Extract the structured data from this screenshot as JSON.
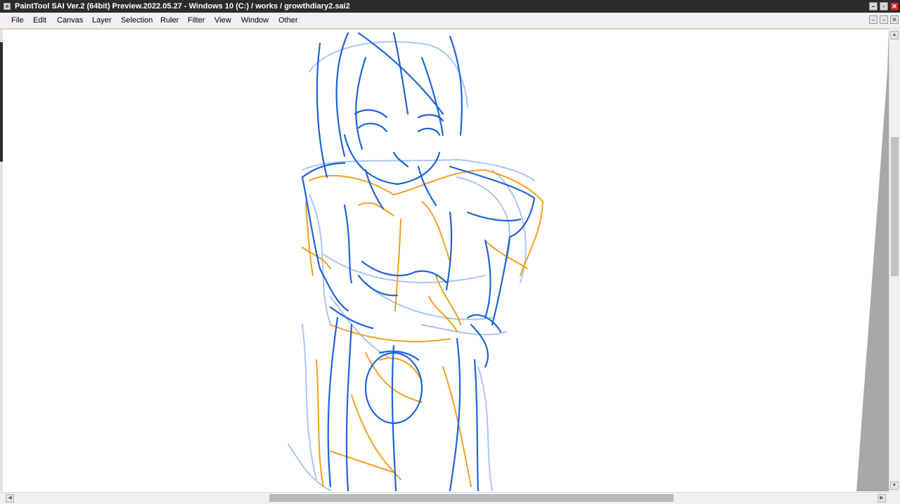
{
  "window": {
    "title": "PaintTool SAI Ver.2 (64bit) Preview.2022.05.27 - Windows 10 (C:) / works / growthdiary2.sai2",
    "minimize_glyph": "–",
    "maximize_glyph": "▫",
    "close_glyph": "✕"
  },
  "menu": {
    "items": [
      {
        "label": "File"
      },
      {
        "label": "Edit"
      },
      {
        "label": "Canvas"
      },
      {
        "label": "Layer"
      },
      {
        "label": "Selection"
      },
      {
        "label": "Ruler"
      },
      {
        "label": "Filter"
      },
      {
        "label": "View"
      },
      {
        "label": "Window"
      },
      {
        "label": "Other"
      }
    ],
    "doc_minimize_glyph": "–",
    "doc_restore_glyph": "▫",
    "doc_close_glyph": "✕"
  },
  "canvas": {
    "content": "sketch-figure",
    "colors": {
      "background": "#ffffff",
      "sketch_blue": "#1e63d6",
      "sketch_light_blue": "#a9c6f2",
      "sketch_orange": "#f0a020"
    }
  },
  "scrollbars": {
    "vertical": {
      "up_glyph": "▲",
      "down_glyph": "▼",
      "position": 0.3
    },
    "horizontal": {
      "left_glyph": "◀",
      "right_glyph": "▶",
      "position": 0.45
    }
  },
  "icons": {
    "app": "painttool-sai-icon"
  }
}
